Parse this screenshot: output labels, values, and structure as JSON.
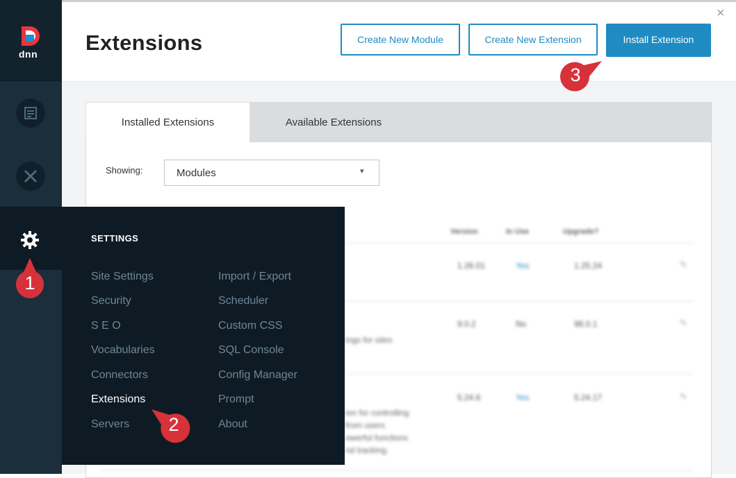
{
  "header": {
    "title": "Extensions",
    "create_module_label": "Create New Module",
    "create_extension_label": "Create New Extension",
    "install_label": "Install Extension",
    "close_glyph": "×"
  },
  "rail": {
    "logo_text": "dnn",
    "icons": [
      "content-icon",
      "tools-icon",
      "gear-icon"
    ]
  },
  "tabs": [
    "Installed Extensions",
    "Available Extensions"
  ],
  "filter": {
    "label": "Showing:",
    "selected": "Modules",
    "caret": "▾"
  },
  "table": {
    "headers": [
      "Version",
      "In Use",
      "Upgrade?"
    ],
    "rows": [
      {
        "version": "1.26.01",
        "in_use": "Yes",
        "upgrade": "1.25.24",
        "desc": ""
      },
      {
        "version": "9.0.2",
        "in_use": "No",
        "upgrade": "98.0.1",
        "desc": "ings for sites"
      },
      {
        "version": "5.24.6",
        "in_use": "Yes",
        "upgrade": "5.24.17",
        "desc": "ion for controlling\nfrom users\nowerful functions\nnd tracking."
      }
    ]
  },
  "settings_menu": {
    "title": "SETTINGS",
    "col1": [
      "Site Settings",
      "Security",
      "S E O",
      "Vocabularies",
      "Connectors",
      "Extensions",
      "Servers"
    ],
    "col2": [
      "Import / Export",
      "Scheduler",
      "Custom CSS",
      "SQL Console",
      "Config Manager",
      "Prompt",
      "About"
    ],
    "active": "Extensions"
  },
  "callouts": [
    "1",
    "2",
    "3"
  ],
  "colors": {
    "accent": "#1e8bc3",
    "rail": "#1a2e3b",
    "flyout": "#0e1b24",
    "callout": "#d7323a"
  }
}
